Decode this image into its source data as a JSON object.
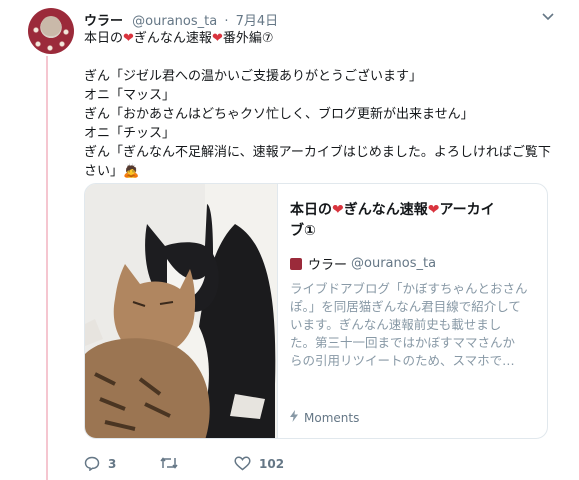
{
  "tweet": {
    "display_name": "ウラー",
    "handle": "@ouranos_ta",
    "separator": "·",
    "date": "7月4日",
    "line1_pre": "本日の",
    "line1_mid": "ぎんなん速報",
    "line1_post": "番外編⑦",
    "body_lines": [
      "ぎん「ジゼル君への温かいご支援ありがとうございます」",
      "オニ「マッス」",
      "ぎん「おかあさんはどちゃクソ忙しく、ブログ更新が出来ません」",
      "オニ「チッス」",
      "ぎん「ぎんなん不足解消に、速報アーカイブはじめました。よろしければご覧下",
      "さい」"
    ],
    "emoji_end": "🙇",
    "heart": "❤"
  },
  "card": {
    "title_pre": "本日の",
    "title_mid": "ぎんなん速報",
    "title_post": "アーカイ",
    "title_line2": "ブ①",
    "author_name": "ウラー",
    "author_handle": "@ouranos_ta",
    "description_lines": [
      "ライブドアブログ「かぼすちゃんとおさん",
      "ぽ。」を同居猫ぎんなん君目線で紹介して",
      "います。ぎんなん速報前史も載せまし",
      "た。第三十一回まではかぼすママさんか",
      "らの引用リツイートのため、スマホで…"
    ],
    "footer_label": "Moments",
    "footer_icon": "bolt-icon"
  },
  "actions": {
    "reply_count": "3",
    "retweet_count": "",
    "like_count": "102"
  },
  "colors": {
    "heart": "#d9343e",
    "thread_line": "#f5c6d0",
    "muted_text": "#657786"
  }
}
